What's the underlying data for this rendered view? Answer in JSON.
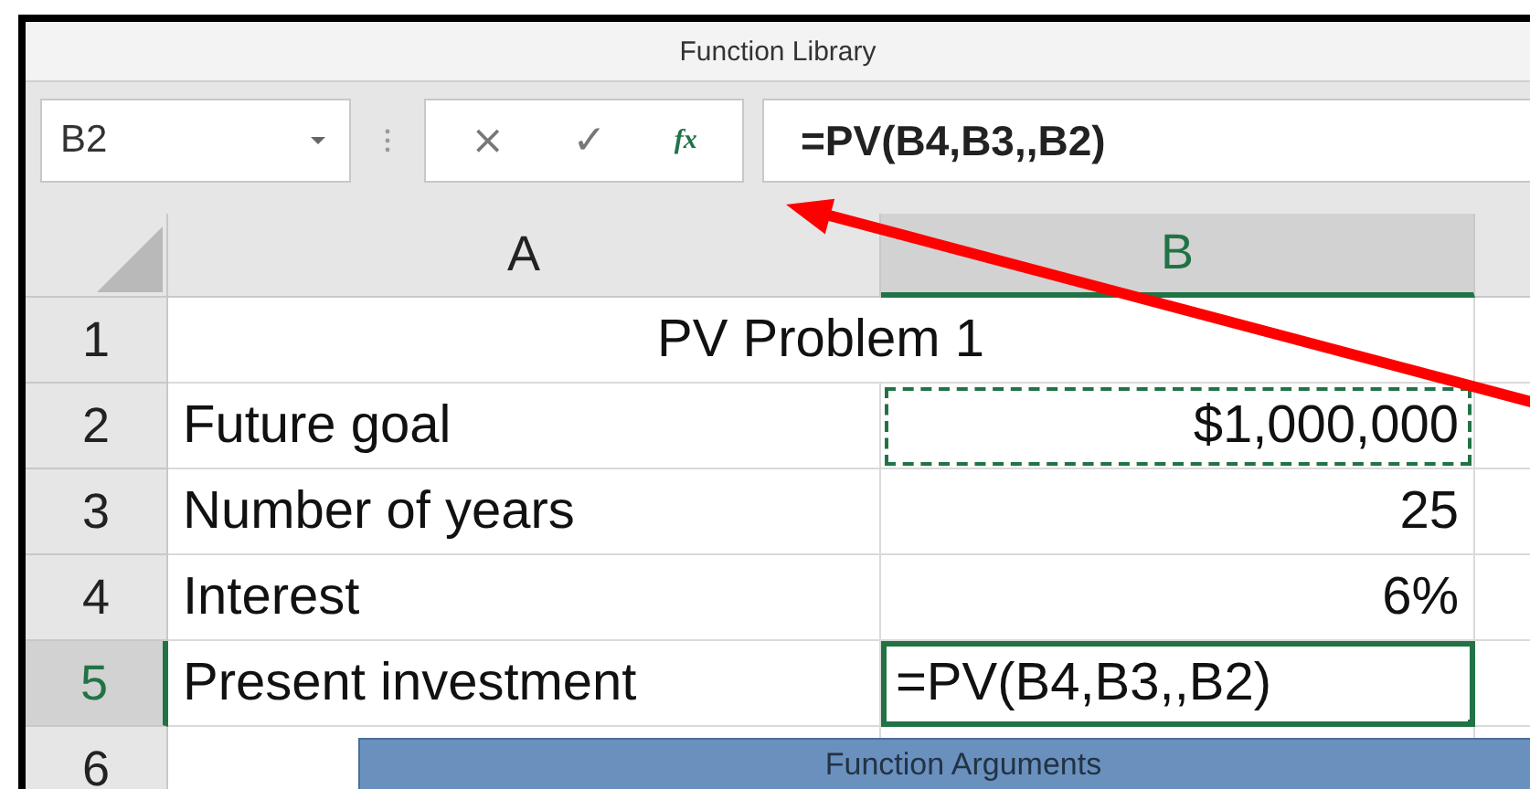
{
  "ribbon": {
    "group_label": "Function Library"
  },
  "formula_bar": {
    "name_box": "B2",
    "cancel": "×",
    "enter": "✓",
    "fx": "fx",
    "formula": "=PV(B4,B3,,B2)"
  },
  "columns": [
    {
      "label": "A",
      "selected": false
    },
    {
      "label": "B",
      "selected": true
    }
  ],
  "rows": [
    {
      "number": "1",
      "selected": false,
      "cells": [
        {
          "text": "PV Problem 1",
          "kind": "title",
          "active": false,
          "marquee": false
        }
      ]
    },
    {
      "number": "2",
      "selected": false,
      "cells": [
        {
          "text": "Future goal",
          "kind": "label",
          "active": false,
          "marquee": false
        },
        {
          "text": "$1,000,000",
          "kind": "number",
          "active": false,
          "marquee": true
        }
      ]
    },
    {
      "number": "3",
      "selected": false,
      "cells": [
        {
          "text": "Number of years",
          "kind": "label",
          "active": false,
          "marquee": false
        },
        {
          "text": "25",
          "kind": "number",
          "active": false,
          "marquee": false
        }
      ]
    },
    {
      "number": "4",
      "selected": false,
      "cells": [
        {
          "text": "Interest",
          "kind": "label",
          "active": false,
          "marquee": false
        },
        {
          "text": "6%",
          "kind": "number",
          "active": false,
          "marquee": false
        }
      ]
    },
    {
      "number": "5",
      "selected": true,
      "cells": [
        {
          "text": "Present investment",
          "kind": "label",
          "active": false,
          "marquee": false
        },
        {
          "text": "=PV(B4,B3,,B2)",
          "kind": "formula",
          "active": true,
          "marquee": false
        }
      ]
    },
    {
      "number": "6",
      "selected": false,
      "cells": []
    }
  ],
  "dialog": {
    "title": "Function Arguments"
  }
}
